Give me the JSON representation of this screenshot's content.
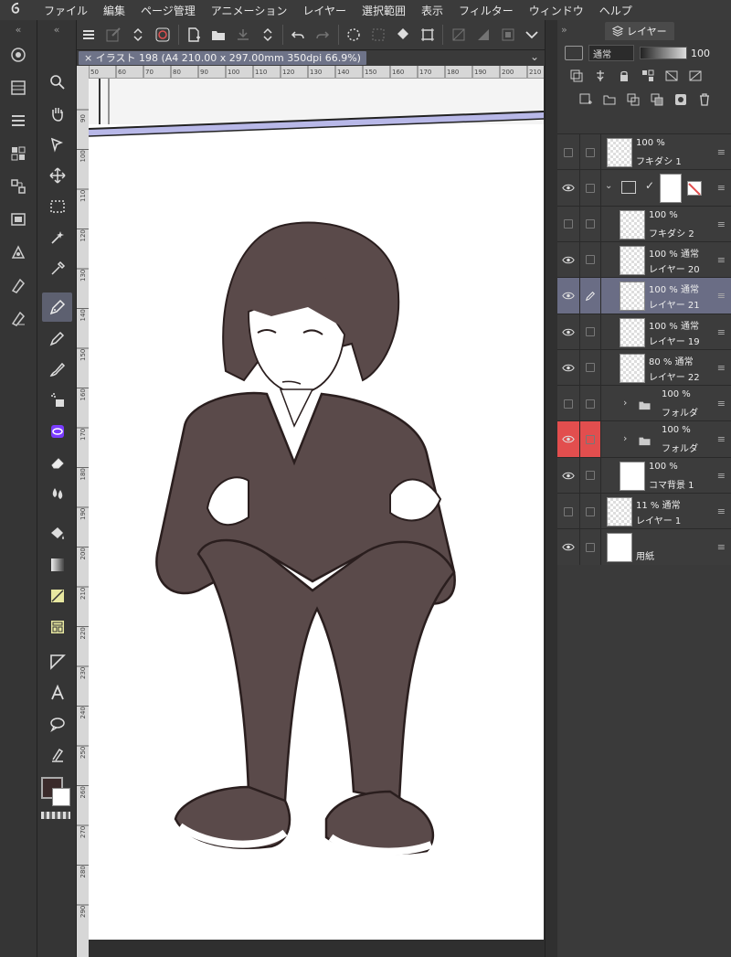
{
  "menu": [
    "ファイル",
    "編集",
    "ページ管理",
    "アニメーション",
    "レイヤー",
    "選択範囲",
    "表示",
    "フィルター",
    "ウィンドウ",
    "ヘルプ"
  ],
  "document": {
    "tab_label": "イラスト 198 (A4 210.00 x 297.00mm 350dpi 66.9%)"
  },
  "ruler": {
    "left_ticks": [
      "90",
      "100",
      "110",
      "120",
      "130",
      "140",
      "150",
      "160",
      "170",
      "180",
      "190",
      "200",
      "210",
      "220",
      "230",
      "240",
      "250",
      "260",
      "270",
      "280",
      "290"
    ],
    "top_ticks": [
      "50",
      "60",
      "70",
      "80",
      "90",
      "100",
      "110",
      "120",
      "130",
      "140",
      "150",
      "160",
      "170",
      "180",
      "190",
      "200",
      "210"
    ]
  },
  "layer_panel": {
    "tab_label": "レイヤー",
    "blend_mode": "通常",
    "opacity": "100",
    "layers": [
      {
        "line1": "100 %",
        "line2": "フキダシ 1",
        "visible": false,
        "selected": false,
        "indent": 0
      },
      {
        "line1": "",
        "line2": "",
        "visible": true,
        "selected": false,
        "indent": 0,
        "folder_open": true
      },
      {
        "line1": "100 %",
        "line2": "フキダシ 2",
        "visible": false,
        "selected": false,
        "indent": 1
      },
      {
        "line1": "100 % 通常",
        "line2": "レイヤー 20",
        "visible": true,
        "selected": false,
        "indent": 1
      },
      {
        "line1": "100 % 通常",
        "line2": "レイヤー 21",
        "visible": true,
        "selected": true,
        "indent": 1
      },
      {
        "line1": "100 % 通常",
        "line2": "レイヤー 19",
        "visible": true,
        "selected": false,
        "indent": 1
      },
      {
        "line1": "80 % 通常",
        "line2": "レイヤー 22",
        "visible": true,
        "selected": false,
        "indent": 1
      },
      {
        "line1": "100 %",
        "line2": "フォルダ",
        "visible": false,
        "selected": false,
        "indent": 1
      },
      {
        "line1": "100 %",
        "line2": "フォルダ",
        "visible": true,
        "selected": false,
        "indent": 1,
        "red": true
      },
      {
        "line1": "100 %",
        "line2": "コマ背景 1",
        "visible": true,
        "selected": false,
        "indent": 1
      },
      {
        "line1": "11 % 通常",
        "line2": "レイヤー 1",
        "visible": false,
        "selected": false,
        "indent": 0
      },
      {
        "line1": "",
        "line2": "用紙",
        "visible": true,
        "selected": false,
        "indent": 0
      }
    ]
  },
  "colors": {
    "main": "#3a2a2a",
    "sub": "#ffffff",
    "selection": "#6a6d85",
    "accent_red": "#e24e4e"
  }
}
